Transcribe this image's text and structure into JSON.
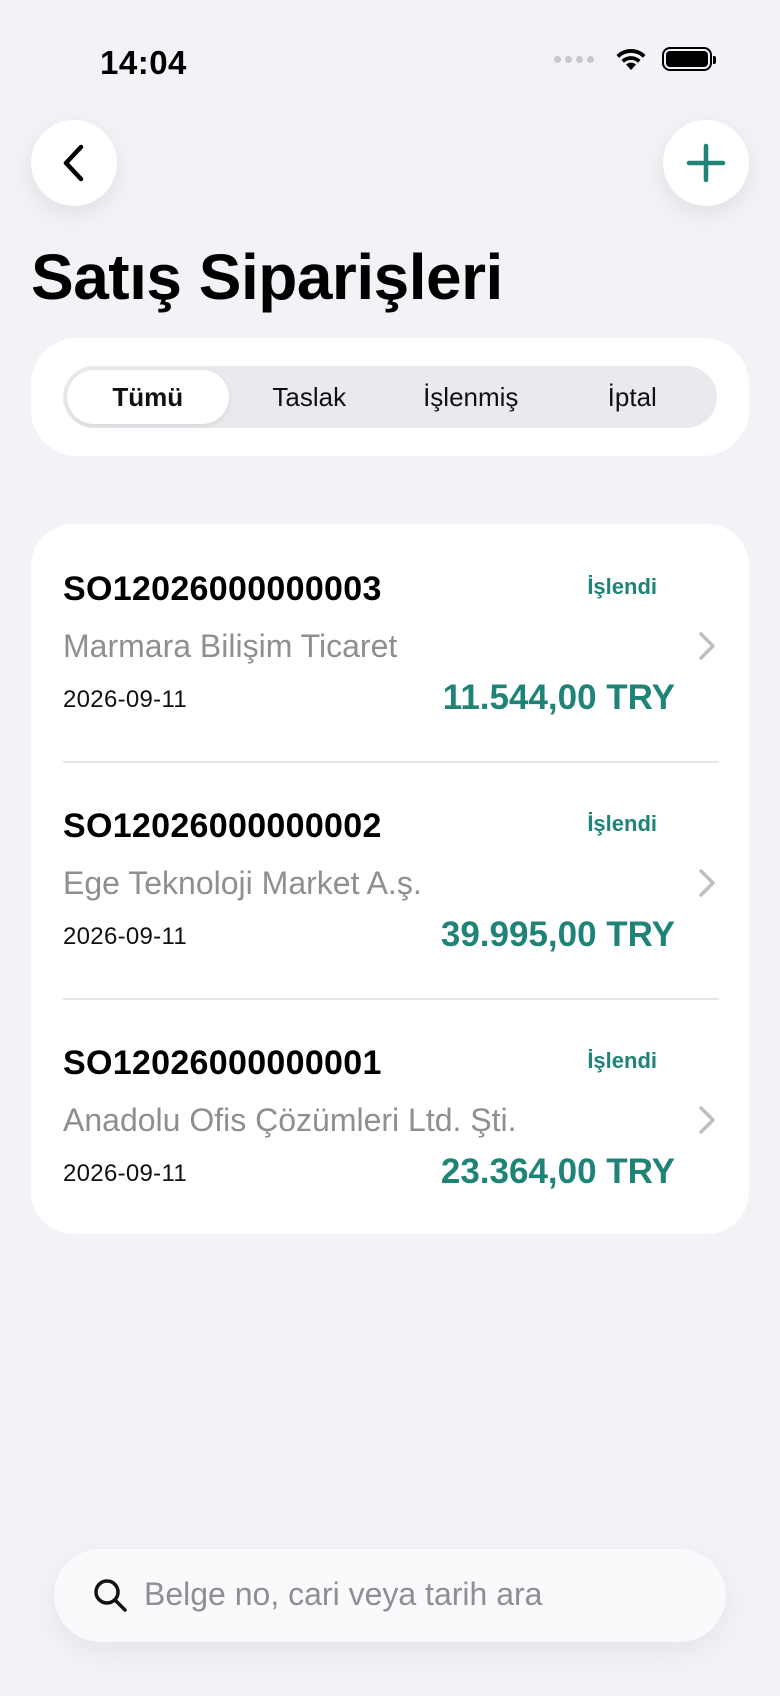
{
  "status_bar": {
    "time": "14:04"
  },
  "header": {
    "title": "Satış Siparişleri",
    "back_icon": "chevron-left-icon",
    "add_icon": "plus-icon",
    "accent_color": "#1F8477"
  },
  "filters": {
    "segments": [
      "Tümü",
      "Taslak",
      "İşlenmiş",
      "İptal"
    ],
    "selected": "Tümü"
  },
  "orders": [
    {
      "number": "SO12026000000003",
      "status": "İşlendi",
      "customer": "Marmara Bilişim Ticaret",
      "date": "2026-09-11",
      "amount": "11.544,00 TRY"
    },
    {
      "number": "SO12026000000002",
      "status": "İşlendi",
      "customer": "Ege Teknoloji Market A.ş.",
      "date": "2026-09-11",
      "amount": "39.995,00 TRY"
    },
    {
      "number": "SO12026000000001",
      "status": "İşlendi",
      "customer": "Anadolu Ofis Çözümleri Ltd. Şti.",
      "date": "2026-09-11",
      "amount": "23.364,00 TRY"
    }
  ],
  "search": {
    "placeholder": "Belge no, cari veya tarih ara"
  }
}
